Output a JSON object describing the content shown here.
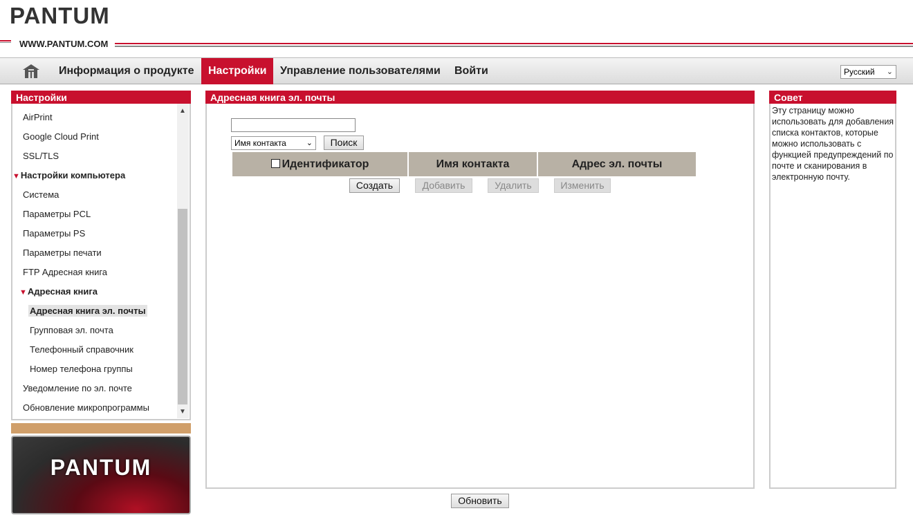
{
  "header": {
    "logo": "PANTUM",
    "website": "WWW.PANTUM.COM"
  },
  "nav": {
    "home_icon": "home-icon",
    "items": [
      "Информация о продукте",
      "Настройки",
      "Управление пользователями",
      "Войти"
    ],
    "active": "Настройки",
    "language": "Русский"
  },
  "sidebar": {
    "title": "Настройки",
    "items": [
      "AirPrint",
      "Google Cloud Print",
      "SSL/TLS",
      "Настройки компьютера",
      "Система",
      "Параметры PCL",
      "Параметры PS",
      "Параметры печати",
      "FTP Адресная книга",
      "Адресная книга",
      "Адресная книга эл. почты",
      "Групповая эл. почта",
      "Телефонный справочник",
      "Номер телефона группы",
      "Уведомление по эл. почте",
      "Обновление микропрограммы"
    ],
    "selected": "Адресная книга эл. почты"
  },
  "brand_card": {
    "text": "PANTUM"
  },
  "main": {
    "title": "Адресная книга эл. почты",
    "search_value": "",
    "field_select": "Имя контакта",
    "search_button": "Поиск",
    "columns": [
      "Идентификатор",
      "Имя контакта",
      "Адрес эл. почты"
    ],
    "buttons": {
      "create": "Создать",
      "add": "Добавить",
      "delete": "Удалить",
      "edit": "Изменить"
    },
    "refresh_button": "Обновить"
  },
  "tip": {
    "title": "Совет",
    "text": "Эту страницу можно использовать для добавления списка контактов, которые можно использовать с функцией предупреждений по почте и сканирования в электронную почту."
  },
  "colors": {
    "accent": "#c8102e",
    "table_header": "#b8b1a5",
    "tan_bar": "#d09f6a"
  }
}
